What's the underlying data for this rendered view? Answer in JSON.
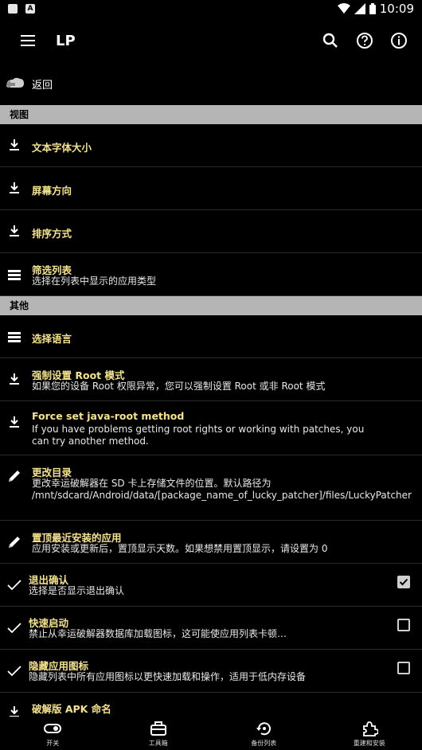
{
  "status_bar": {
    "time": "10:09"
  },
  "app_bar": {
    "title": "LP"
  },
  "back": {
    "label": "返回"
  },
  "sections": {
    "view": "视图",
    "other": "其他"
  },
  "view_items": [
    {
      "title": "文本字体大小",
      "icon": "download-icon"
    },
    {
      "title": "屏幕方向",
      "icon": "download-icon"
    },
    {
      "title": "排序方式",
      "icon": "download-icon"
    },
    {
      "title": "筛选列表",
      "subtitle": "选择在列表中显示的应用类型",
      "icon": "list-icon"
    }
  ],
  "other_items": [
    {
      "title": "选择语言",
      "icon": "list-icon"
    },
    {
      "title": "强制设置 Root 模式",
      "subtitle": "如果您的设备 Root 权限异常，您可以强制设置 Root 或非 Root 模式",
      "icon": "download-icon"
    },
    {
      "title": "Force set java-root method",
      "subtitle": "If you have problems getting root rights or working with patches, you can try another method.",
      "icon": "download-icon"
    },
    {
      "title": "更改目录",
      "subtitle": "更改幸运破解器在 SD 卡上存储文件的位置。默认路径为 /mnt/sdcard/Android/data/[package_name_of_lucky_patcher]/files/LuckyPatcher",
      "icon": "pencil-icon"
    },
    {
      "title": "置顶最近安装的应用",
      "subtitle": "应用安装或更新后，置顶显示天数。如果想禁用置顶显示，请设置为 0",
      "icon": "pencil-icon"
    },
    {
      "title": "退出确认",
      "subtitle": "选择是否显示退出确认",
      "checked": true
    },
    {
      "title": "快速启动",
      "subtitle": "禁止从幸运破解器数据库加载图标，这可能使应用列表卡顿…",
      "checked": false
    },
    {
      "title": "隐藏应用图标",
      "subtitle": "隐藏列表中所有应用图标以更快速加载和操作，适用于低内存设备",
      "checked": false
    },
    {
      "title": "破解版 APK 命名",
      "icon": "download-icon"
    }
  ],
  "bottom_nav": [
    {
      "label": "开关",
      "icon": "toggle-icon"
    },
    {
      "label": "工具箱",
      "icon": "toolbox-icon"
    },
    {
      "label": "备份列表",
      "icon": "backup-icon"
    },
    {
      "label": "重建和安装",
      "icon": "puzzle-icon"
    }
  ]
}
